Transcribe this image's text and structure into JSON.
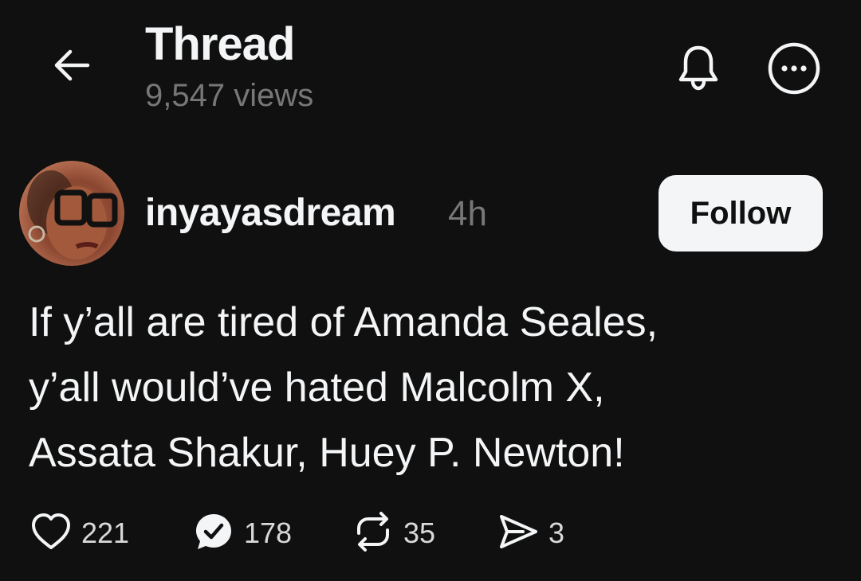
{
  "header": {
    "title": "Thread",
    "views": "9,547 views",
    "back_icon": "back-arrow-icon",
    "bell_icon": "bell-icon",
    "more_icon": "more-options-icon"
  },
  "post": {
    "author": "inyayasdream",
    "time": "4h",
    "follow_label": "Follow",
    "text_lines": [
      "If y’all are tired of Amanda Seales,",
      "y’all would’ve hated Malcolm X,",
      "Assata Shakur, Huey P. Newton!"
    ],
    "actions": {
      "likes": "221",
      "replies": "178",
      "reposts": "35",
      "shares": "3"
    }
  },
  "colors": {
    "background": "#101010",
    "primary_text": "#f3f5f7",
    "secondary_text": "#777777",
    "follow_button_bg": "#f3f5f7",
    "follow_button_text": "#101010"
  }
}
